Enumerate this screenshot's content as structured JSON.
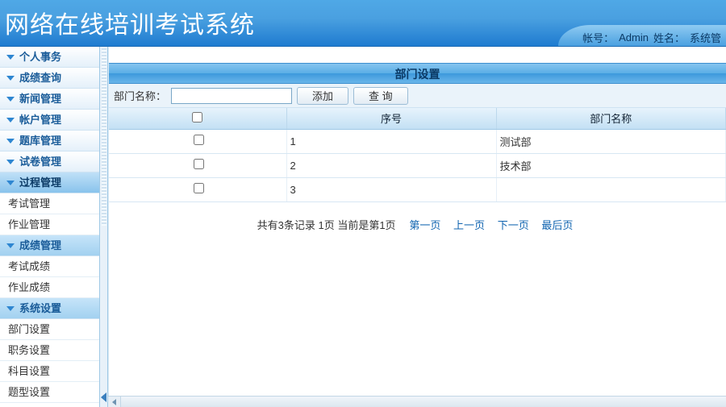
{
  "header": {
    "title": "网络在线培训考试系统",
    "account_label": "帐号：",
    "account_value": "Admin",
    "name_label": "姓名：",
    "name_value": "系统管"
  },
  "sidebar": {
    "groups": [
      {
        "label": "个人事务",
        "type": "group"
      },
      {
        "label": "成绩查询",
        "type": "group"
      },
      {
        "label": "新闻管理",
        "type": "group"
      },
      {
        "label": "帐户管理",
        "type": "group"
      },
      {
        "label": "题库管理",
        "type": "group"
      },
      {
        "label": "试卷管理",
        "type": "group"
      },
      {
        "label": "过程管理",
        "type": "group",
        "expanded": true,
        "active": true,
        "children": [
          {
            "label": "考试管理"
          },
          {
            "label": "作业管理"
          }
        ]
      },
      {
        "label": "成绩管理",
        "type": "group",
        "expanded": true,
        "highlight": true,
        "children": [
          {
            "label": "考试成绩"
          },
          {
            "label": "作业成绩"
          }
        ]
      },
      {
        "label": "系统设置",
        "type": "group",
        "expanded": true,
        "highlight": true,
        "children": [
          {
            "label": "部门设置"
          },
          {
            "label": "职务设置"
          },
          {
            "label": "科目设置"
          },
          {
            "label": "题型设置"
          }
        ]
      }
    ]
  },
  "page": {
    "title": "部门设置",
    "filter_label": "部门名称：",
    "filter_value": "",
    "btn_add": "添加",
    "btn_search": "查 询"
  },
  "table": {
    "headers": {
      "check": "",
      "index": "序号",
      "name": "部门名称"
    },
    "rows": [
      {
        "index": "1",
        "name": "测试部"
      },
      {
        "index": "2",
        "name": "技术部"
      },
      {
        "index": "3",
        "name": ""
      }
    ]
  },
  "pager": {
    "summary": "共有3条记录 1页 当前是第1页",
    "first": "第一页",
    "prev": "上一页",
    "next": "下一页",
    "last": "最后页"
  }
}
